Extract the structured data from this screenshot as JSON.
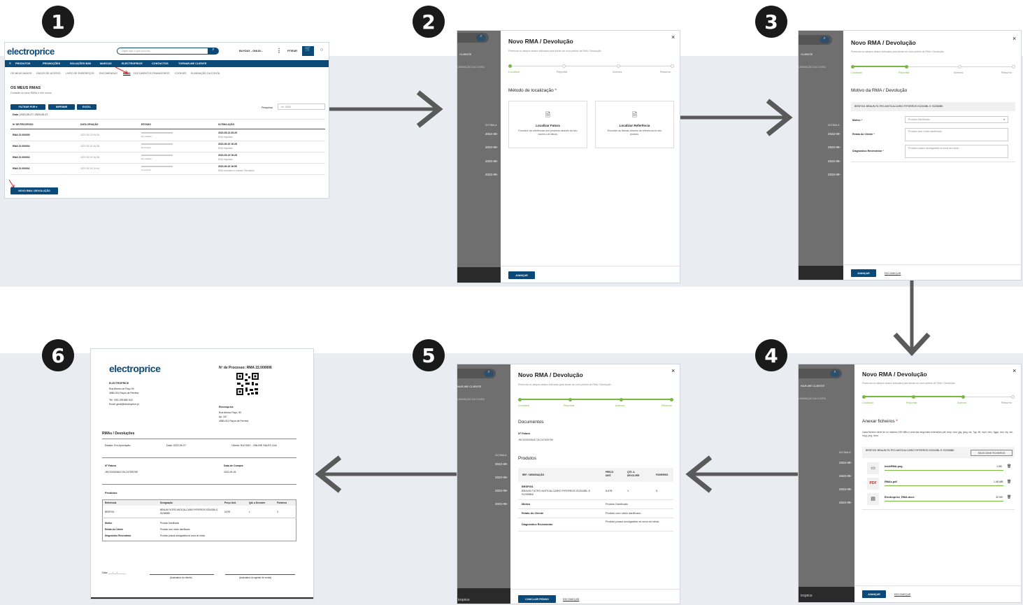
{
  "steps": [
    "1",
    "2",
    "3",
    "4",
    "5",
    "6"
  ],
  "store": {
    "logo": "electroprice",
    "search_placeholder": "Digite aqui o que procura...",
    "account": "BUYDAY - ONLIN...",
    "lang": "PT/EUR",
    "nav": [
      "PRODUTOS",
      "PROMOÇÕES",
      "SOLUÇÕES B2B",
      "MARCAS",
      "ELECTROPRICE",
      "CONTACTOS",
      "TORNAR-ME CLIENTE"
    ],
    "subnav": [
      "OS MEUS DADOS",
      "DADOS DE ACESSO",
      "LIVRO DE ENDEREÇOS",
      "ENCOMENDAS",
      "RMAS",
      "DOCUMENTOS FINANCEIROS",
      "COOKIES",
      "ELIMINAÇÃO DA CONTA"
    ],
    "page_title": "OS MEUS RMAS",
    "page_sub": "Consulte os seus RMAs e crie novos",
    "filter_btn": "FILTRAR POR",
    "print_btn": "IMPRIMIR",
    "excel_btn": "EXCEL",
    "search_label": "Pesquisar",
    "search_ph": "ex: 4000",
    "date_label": "Data",
    "date_value": "2022-09-27 / 2022-09-27",
    "cols": [
      "Nº DE PROCESSO",
      "DATA CRIAÇÃO",
      "ESTADO",
      "ÚLTIMA AÇÃO"
    ],
    "rows": [
      {
        "id": "RMA 22.000005",
        "date": "2022-09-21 09:26",
        "state": "Em análise",
        "last_date": "2022-09-21 09:26",
        "last": "RMA registado"
      },
      {
        "id": "RMA 22.000004",
        "date": "2022-09-20 16:28",
        "state": "Recusado",
        "last_date": "2022-09-20 16:28",
        "last": "RMA registado"
      },
      {
        "id": "RMA 22.000003",
        "date": "2022-09-19 16:28",
        "state": "Em análise",
        "last_date": "2022-09-19 16:28",
        "last": "RMA registado"
      },
      {
        "id": "RMA 22.000002",
        "date": "2022-09-19 10:44",
        "state": "Concluído",
        "last_date": "2022-09-20 16:59",
        "last": "RMA colocado no estado: Recusado"
      }
    ],
    "new_btn": "NOVO RMA / DEVOLUÇÃO"
  },
  "modal": {
    "title": "Novo RMA / Devolução",
    "subtitle": "Preencha os campos abaixo indicados para iniciar um novo pedido de RMA / Devolução.",
    "steps": [
      "Localizar",
      "Reportar",
      "Anexos",
      "Resumo"
    ],
    "advance": "AVANÇAR",
    "restart": "RECOMEÇAR",
    "finish": "CONCLUIR PEDIDO",
    "close": "×"
  },
  "bg": {
    "cliente": "CLIENTE",
    "tornar": "NAR-ME CLIENTE",
    "elim": "LIMINAÇÃO DA CONTA",
    "ultima": "ÚLTIMA A",
    "dates": [
      "2022-09-",
      "2022-09-",
      "2022-09-",
      "2022-09-"
    ],
    "rma": "RMA regi",
    "footer": "troprice"
  },
  "s2": {
    "section": "Método de localização",
    "opt1_title": "Localizar Fatura",
    "opt1_desc": "Encontre as referências dos produtos através do seu número de fatura.",
    "opt2_title": "Localizar Referência",
    "opt2_desc": "Encontre as faturas através da referência do seu produto."
  },
  "s3": {
    "section": "Motivo da RMA / Devolução",
    "product": "BRSF001 BRAUN FILTRO ANTICALCARIO P/FERROS IS2043BL E IS2055BK",
    "motivo_label": "Motivo",
    "motivo_value": "Produto Danificado",
    "relato_label": "Relato do Cliente",
    "relato_value": "Produto com rótulo danificado.",
    "diag_label": "Diagnóstico Revendedor",
    "diag_value": "Produto possui amolgadela na zona do rótulo."
  },
  "s4": {
    "section": "Anexar ficheiros",
    "info": "Cada ficheiro deve ter no máximo 150 MBs e uma das seguintes extensões pdf, bmp, mov, jpg, jpeg, rar, 7gp, ifif, mp4, heic, 3gpp, doc, zip, avi, mpg, png, docx.",
    "product": "BRSF001 BRAUN FILTRO ANTICALCARIO P/FERROS IS2043BL E IS2055BK",
    "select_btn": "SELECIONE FICHEIROS",
    "files": [
      {
        "name": "testeRMA.png",
        "size": "1 KB"
      },
      {
        "name": "RMAs.pdf",
        "size": "1.46 MB"
      },
      {
        "name": "Electroprice_RMA.docx",
        "size": "32 KB"
      }
    ]
  },
  "s5": {
    "docs_title": "Documentos",
    "invoice_label": "Nº Fatura",
    "invoice_value": "JNY220530641726,247925769",
    "products_title": "Produtos",
    "cols": [
      "REF. / DESIGNAÇÃO",
      "PREÇO UNIT.",
      "QTD. A DEVOLVER",
      "FICHEIROS"
    ],
    "ref": "BRSF001",
    "desc": "BRAUN FILTRO ANTICALCARIO P/FERROS IS2043BL E IS2055BK",
    "price": "5,57€",
    "qty": "1",
    "files": "3",
    "motivo_l": "Motivo",
    "motivo_v": "Produto Danificado",
    "relato_l": "Relato do Cliente",
    "relato_v": "Produto com rótulo danificado.",
    "diag_l": "Diagnóstico Revendedor",
    "diag_v": "Produto possui amolgadela na zona do rótulo."
  },
  "s6": {
    "logo": "electroprice",
    "process": "Nº de Processo: RMA 22.000006",
    "company": "ELECTROPRICE",
    "addr1": "Rua Afonso de Paço 90",
    "addr2": "4580-031 Paços de Ferreira",
    "tel": "Tel: +351 255 880 515",
    "email": "Email: geral@electroprice.pt",
    "client_name": "Electroprice",
    "client_addr1": "Rua Afonso Paço, 90",
    "client_addr2": "Ap. 167",
    "client_addr3": "4580-031 Paços de Ferreira",
    "section": "RMAs / Devoluções",
    "state": "Estado: Em Aprovação",
    "date": "Data: 2022-09-27",
    "client": "Cliente: BUYDAY - ONLINE SALES LDA",
    "inv_label": "Nº Fatura",
    "inv_value": "JNY220530641726,247925769",
    "buy_label": "Data de Compra",
    "buy_value": "2022-09-26",
    "products": "Produtos",
    "cols": [
      "Referência",
      "Designação",
      "Preço Unit.",
      "Qtd. a Devolver",
      "Ficheiros"
    ],
    "ref": "BRSF001",
    "desc": "BRAUN FILTRO ANTICALCARIO P/FERROS IS2043BL E IS2055BK",
    "price": "5,57€",
    "qty": "1",
    "files": "3",
    "motivo_l": "Motivo",
    "motivo_v": "Produto Danificado",
    "relato_l": "Relato do Cliente",
    "relato_v": "Produto com rótulo danificado.",
    "diag_l": "Diagnóstico Revendedor",
    "diag_v": "Produto possui amolgadela na zona do rótulo.",
    "date_line": "Data: ___/___/______",
    "sig_client": "(Assinatura do cliente)",
    "sig_agent": "(Assinatura do agente de venda)"
  },
  "colors": {
    "navy": "#0b4a78",
    "green": "#79b843",
    "step": "#1a1a1a",
    "arrow": "#5a5a5a"
  }
}
